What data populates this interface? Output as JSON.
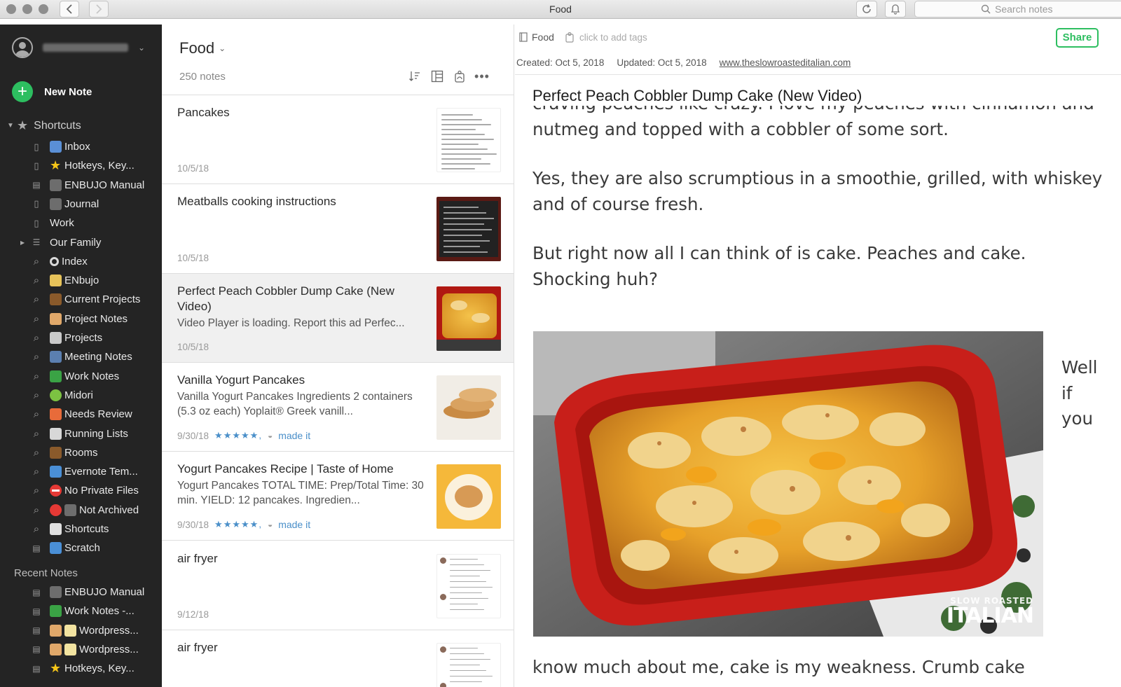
{
  "window": {
    "title": "Food"
  },
  "toolbar": {
    "search_placeholder": "Search notes"
  },
  "sidebar": {
    "new_note_label": "New Note",
    "shortcuts_heading": "Shortcuts",
    "shortcuts": [
      {
        "kind": "notebook",
        "emoji": "inbox-tray",
        "color": "#5a8fd6",
        "label": "Inbox"
      },
      {
        "kind": "notebook",
        "emoji": "star",
        "color": "#f5c518",
        "label": "Hotkeys, Key..."
      },
      {
        "kind": "note",
        "emoji": "book",
        "color": "#6d6d6d",
        "label": "ENBUJO Manual"
      },
      {
        "kind": "notebook",
        "emoji": "book",
        "color": "#6d6d6d",
        "label": "Journal"
      },
      {
        "kind": "notebook",
        "emoji": "",
        "color": "",
        "label": "Work"
      },
      {
        "kind": "stack",
        "emoji": "",
        "color": "",
        "label": "Our Family",
        "expandable": true
      },
      {
        "kind": "search",
        "emoji": "dark-circle",
        "color": "#d9d9d9",
        "label": "Index"
      },
      {
        "kind": "search",
        "emoji": "ledger",
        "color": "#e7c35a",
        "label": "ENbujo"
      },
      {
        "kind": "search",
        "emoji": "briefcase",
        "color": "#8a5a2b",
        "label": "Current Projects"
      },
      {
        "kind": "search",
        "emoji": "folder",
        "color": "#e0a86a",
        "label": "Project Notes"
      },
      {
        "kind": "search",
        "emoji": "card-index",
        "color": "#c9c9c9",
        "label": "Projects"
      },
      {
        "kind": "search",
        "emoji": "people",
        "color": "#5b7fb0",
        "label": "Meeting Notes"
      },
      {
        "kind": "search",
        "emoji": "green-book",
        "color": "#3aa345",
        "label": "Work Notes"
      },
      {
        "kind": "search",
        "emoji": "green-apple",
        "color": "#7cc242",
        "label": "Midori"
      },
      {
        "kind": "search",
        "emoji": "rainbow",
        "color": "#e86b3a",
        "label": "Needs Review"
      },
      {
        "kind": "search",
        "emoji": "clipboard",
        "color": "#d8d8d8",
        "label": "Running Lists"
      },
      {
        "kind": "search",
        "emoji": "door",
        "color": "#8a5a2b",
        "label": "Rooms"
      },
      {
        "kind": "search",
        "emoji": "new-button",
        "color": "#4a8fd6",
        "label": "Evernote Tem..."
      },
      {
        "kind": "search",
        "emoji": "no-entry",
        "color": "#e53935",
        "label": "No Private Files"
      },
      {
        "kind": "search",
        "emoji": "red-circle",
        "color": "#e53935",
        "label": "Not Archived",
        "extra_emoji_color": "#6d6d6d"
      },
      {
        "kind": "search",
        "emoji": "scissors",
        "color": "#e0e0e0",
        "label": "Shortcuts"
      },
      {
        "kind": "note",
        "emoji": "arrows",
        "color": "#4a8fd6",
        "label": "Scratch"
      }
    ],
    "recent_heading": "Recent Notes",
    "recent": [
      {
        "kind": "note",
        "emoji": "book",
        "color": "#6d6d6d",
        "label": "ENBUJO Manual"
      },
      {
        "kind": "note",
        "emoji": "green-book",
        "color": "#3aa345",
        "label": "Work Notes -..."
      },
      {
        "kind": "note",
        "emoji": "folder",
        "color": "#e0a86a",
        "label": "Wordpress...",
        "extra_emoji_color": "#f2e3a0"
      },
      {
        "kind": "note",
        "emoji": "folder",
        "color": "#e0a86a",
        "label": "Wordpress...",
        "extra_emoji_color": "#f2e3a0"
      },
      {
        "kind": "note",
        "emoji": "star",
        "color": "#f5c518",
        "label": "Hotkeys, Key..."
      }
    ]
  },
  "notelist": {
    "title": "Food",
    "count": "250 notes",
    "notes": [
      {
        "title": "Pancakes",
        "snippet": "",
        "date": "10/5/18",
        "thumb": "recipe-document",
        "selected": false
      },
      {
        "title": "Meatballs cooking instructions",
        "snippet": "",
        "date": "10/5/18",
        "thumb": "package-instructions",
        "selected": false
      },
      {
        "title": "Perfect Peach Cobbler Dump Cake (New Video)",
        "snippet": "Video Player is loading. Report this ad Perfec...",
        "date": "10/5/18",
        "thumb": "cobbler",
        "selected": true
      },
      {
        "title": "Vanilla Yogurt Pancakes",
        "snippet": "Vanilla Yogurt Pancakes Ingredients 2 containers (5.3 oz each) Yoplait® Greek vanill...",
        "date": "9/30/18",
        "stars": "★★★★★,",
        "tag": "made it",
        "thumb": "pancake-stack",
        "selected": false
      },
      {
        "title": "Yogurt Pancakes Recipe | Taste of Home",
        "snippet": "Yogurt Pancakes TOTAL TIME: Prep/Total Time: 30 min. YIELD: 12 pancakes. Ingredien...",
        "date": "9/30/18",
        "stars": "★★★★★,",
        "tag": "made it",
        "thumb": "pancake-plate",
        "selected": false
      },
      {
        "title": "air fryer",
        "snippet": "",
        "date": "9/12/18",
        "thumb": "comments",
        "selected": false
      },
      {
        "title": "air fryer",
        "snippet": "",
        "date": "",
        "thumb": "comments",
        "selected": false
      }
    ]
  },
  "editor": {
    "notebook": "Food",
    "tags_placeholder": "click to add tags",
    "share_label": "Share",
    "created": "Created: Oct 5, 2018",
    "updated": "Updated: Oct 5, 2018",
    "url": "www.theslowroasteditalian.com",
    "title": "Perfect Peach Cobbler Dump Cake (New Video)",
    "paragraphs": [
      [
        "craving peaches like crazy.  I love my peaches with cinnamon and",
        "nutmeg and topped with a cobbler of some sort."
      ],
      [
        "Yes, they are also scrumptious in a smoothie, grilled, with whiskey",
        "and of course fresh."
      ],
      [
        "But right now all I can think of is cake.  Peaches and cake.",
        "Shocking huh?"
      ]
    ],
    "side_text": [
      "Well",
      "if",
      "you"
    ],
    "bottom_text": "know much about me, cake is my weakness.  Crumb cake",
    "image_watermark_top": "SLOW ROASTED",
    "image_watermark_main": "ITALIAN"
  }
}
